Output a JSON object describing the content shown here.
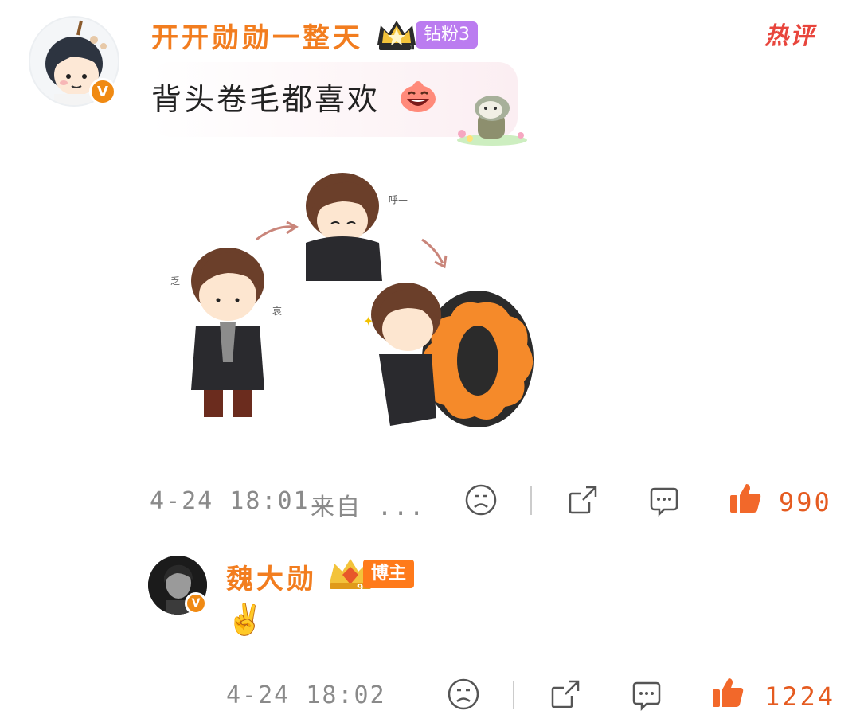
{
  "main_comment": {
    "username": "开开勋勋一整天",
    "fan_badge": "钻粉3",
    "hot_tag": "热评",
    "text": "背头卷毛都喜欢",
    "timestamp": "4-24 18:01",
    "source": "来自 ...",
    "like_count": "990",
    "colors": {
      "username": "#f27d1f",
      "fan_badge": "#bb7cf0",
      "hot_tag": "#e8453c",
      "like": "#e55b20"
    }
  },
  "reply": {
    "username": "魏大勋",
    "badge": "博主",
    "badge_level": "9",
    "text": "✌️",
    "timestamp": "4-24 18:02",
    "like_count": "1224"
  },
  "icons": {
    "verified": "verified-v-icon",
    "crown": "crown-icon",
    "dislike": "dislike-face-icon",
    "share": "share-icon",
    "comment": "comment-icon",
    "like": "thumbs-up-icon"
  }
}
